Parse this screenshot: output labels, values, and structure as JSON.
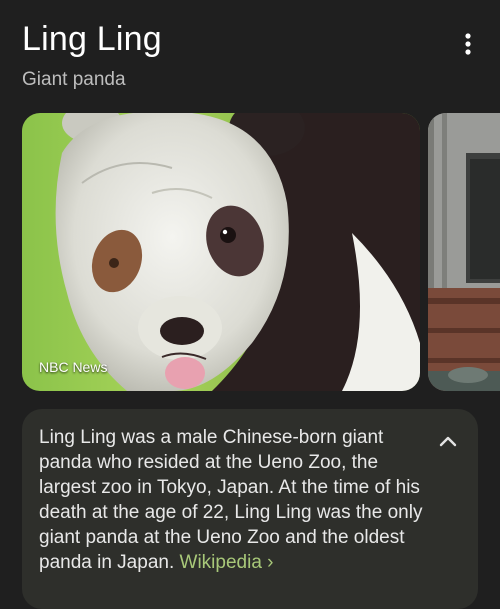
{
  "header": {
    "title": "Ling Ling",
    "subtitle": "Giant panda"
  },
  "images": [
    {
      "source": "NBC News",
      "alt": "Giant panda Ling Ling"
    },
    {
      "source": "",
      "alt": "Ueno Zoo enclosure"
    }
  ],
  "description": {
    "text": "Ling Ling was a male Chinese-born giant panda who resided at the Ueno Zoo, the largest zoo in Tokyo, Japan. At the time of his death at the age of 22, Ling Ling was the only giant panda at the Ueno Zoo and the oldest panda in Japan. ",
    "link_label": "Wikipedia",
    "link_arrow": "›"
  },
  "icons": {
    "more": "more-vert-icon",
    "collapse": "chevron-up-icon"
  },
  "colors": {
    "background": "#1f1f1f",
    "card": "#2e2f2b",
    "link": "#a8c879"
  }
}
